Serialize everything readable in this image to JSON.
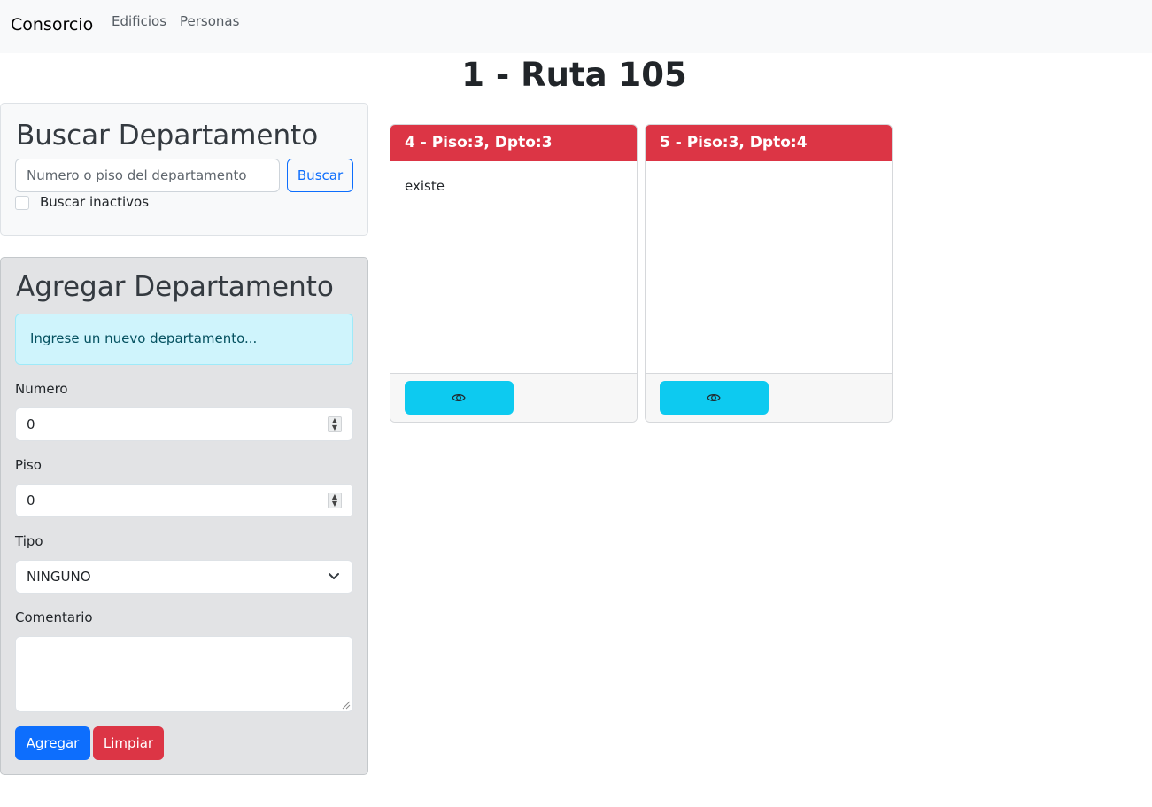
{
  "navbar": {
    "brand": "Consorcio",
    "links": [
      {
        "label": "Edificios"
      },
      {
        "label": "Personas"
      }
    ]
  },
  "page": {
    "title": "1 - Ruta 105"
  },
  "search": {
    "heading": "Buscar Departamento",
    "placeholder": "Numero o piso del departamento",
    "value": "",
    "button_label": "Buscar",
    "inactive_label": "Buscar inactivos",
    "inactive_checked": false
  },
  "add_form": {
    "heading": "Agregar Departamento",
    "info": "Ingrese un nuevo departamento...",
    "numero": {
      "label": "Numero",
      "value": "0"
    },
    "piso": {
      "label": "Piso",
      "value": "0"
    },
    "tipo": {
      "label": "Tipo",
      "value": "NINGUNO"
    },
    "comentario": {
      "label": "Comentario",
      "value": ""
    },
    "add_label": "Agregar",
    "clear_label": "Limpiar"
  },
  "departments": [
    {
      "title": "4 - Piso:3, Dpto:3",
      "comment": "existe",
      "view_icon": "eye-icon"
    },
    {
      "title": "5 - Piso:3, Dpto:4",
      "comment": "",
      "view_icon": "eye-icon"
    }
  ],
  "colors": {
    "primary": "#0d6efd",
    "danger": "#dc3545",
    "info": "#0dcaf0",
    "navbar_bg": "#f8f9fa"
  }
}
